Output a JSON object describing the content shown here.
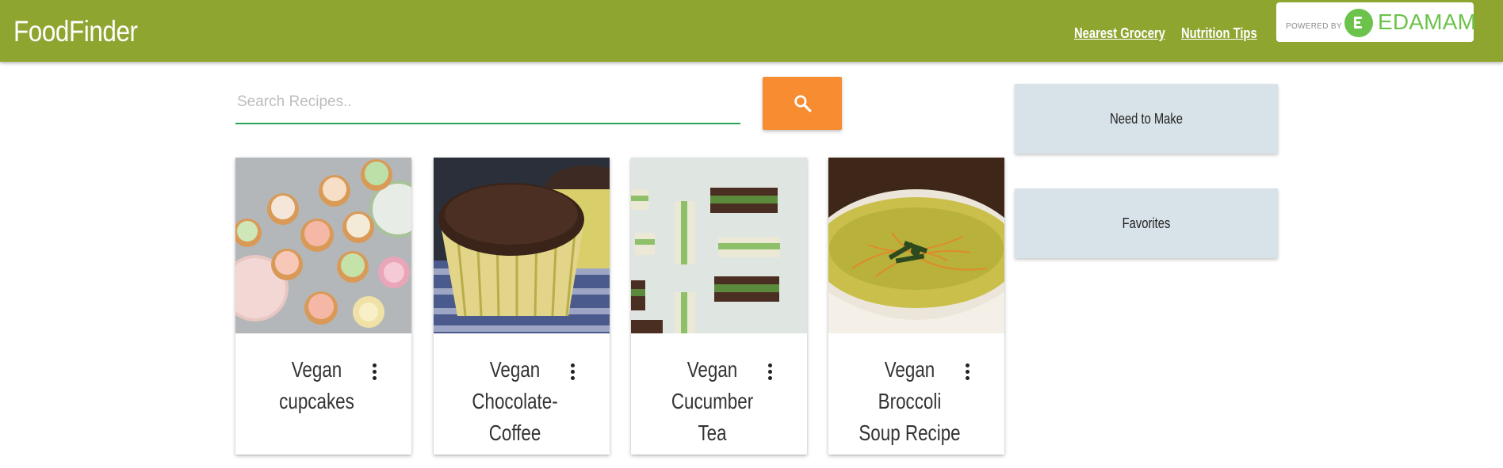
{
  "header": {
    "brand": "FoodFinder",
    "links": [
      "Nearest Grocery",
      "Nutrition Tips"
    ],
    "badge": {
      "powered_by": "POWERED BY",
      "name": "EDAMAM"
    }
  },
  "search": {
    "placeholder": "Search Recipes..",
    "value": ""
  },
  "recipes": [
    {
      "title": "Vegan cupcakes",
      "image": "cupcakes-photo"
    },
    {
      "title": "Vegan Chocolate-Coffee Muffins",
      "image": "chocolate-muffin-photo"
    },
    {
      "title": "Vegan Cucumber Tea Sandwiches",
      "image": "tea-sandwiches-photo"
    },
    {
      "title": "Vegan Broccoli Soup Recipe",
      "image": "broccoli-soup-photo"
    }
  ],
  "sidebar": {
    "need_to_make": "Need to Make",
    "favorites": "Favorites"
  },
  "colors": {
    "header_bg": "#8ea530",
    "search_button": "#f78c31",
    "search_underline": "#26a55a",
    "sidebar_button": "#d8e3e9",
    "edamam_green": "#6cc24a"
  },
  "icons": {
    "search_button": "search-icon",
    "card_menu": "more-vert-icon",
    "edamam_logo": "edamam-logo-icon"
  }
}
